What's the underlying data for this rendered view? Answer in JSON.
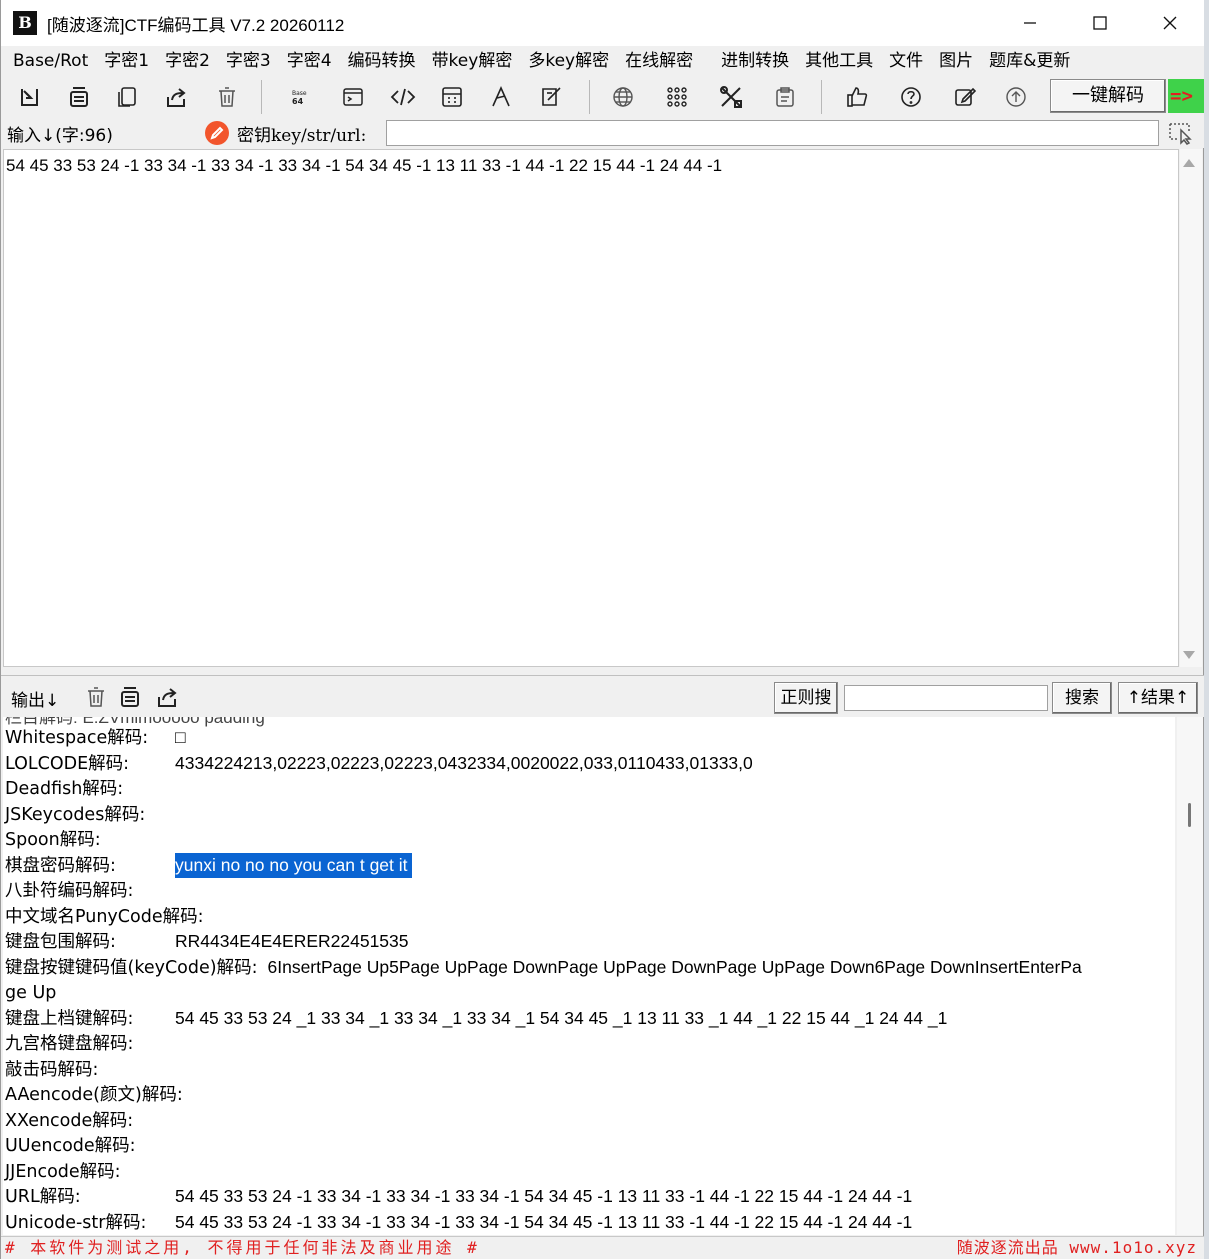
{
  "window": {
    "logo_text": "B",
    "title": "[随波逐流]CTF编码工具 V7.2  20260112"
  },
  "menu": [
    "Base/Rot",
    "字密1",
    "字密2",
    "字密3",
    "字密4",
    "编码转换",
    "带key解密",
    "多key解密",
    "在线解密",
    "进制转换",
    "其他工具",
    "文件",
    "图片",
    "题库&更新"
  ],
  "toolbar": {
    "decode_all": "一键解码",
    "arrow": "=>"
  },
  "input": {
    "label": "输入↓(字:96)",
    "key_label": "密钥key/str/url:",
    "key_value": "",
    "text": "54 45 33 53 24 -1 33 34 -1 33 34 -1 33 34 -1 54 34 45 -1 13 11 33 -1 44 -1 22 15 44 -1 24 44 -1"
  },
  "output_bar": {
    "label": "输出↓",
    "regex_button": "正则搜",
    "regex_value": "",
    "search_button": "搜索",
    "result_button": "↑结果↑"
  },
  "output": {
    "cutoff_line": "栏目解码:        E:ZVmlmooooo padding",
    "lines": [
      {
        "label": "Whitespace解码:",
        "value": "□"
      },
      {
        "label": "LOLCODE解码:",
        "value": "4334224213,02223,02223,02223,0432334,0020022,033,0110433,01333,0"
      },
      {
        "label": "Deadfish解码:",
        "value": ""
      },
      {
        "label": "JSKeycodes解码:",
        "value": ""
      },
      {
        "label": "Spoon解码:",
        "value": ""
      },
      {
        "label": "棋盘密码解码:",
        "value": "yunxi no no no you can t get it",
        "selected": true
      },
      {
        "label": "八卦符编码解码:",
        "value": ""
      },
      {
        "label": "中文域名PunyCode解码:",
        "value": ""
      },
      {
        "label": "键盘包围解码:",
        "value": "RR4434E4E4ERER22451535"
      },
      {
        "label": "键盘按键键码值(keyCode)解码:",
        "value": "6InsertPage Up5Page UpPage DownPage UpPage DownPage UpPage Down6Page DownInsertEnterPa",
        "inline": true
      },
      {
        "label": "ge Up",
        "value": ""
      },
      {
        "label": "键盘上档键解码:",
        "value": "54 45 33 53 24 _1 33 34 _1 33 34 _1 33 34 _1 54 34 45 _1 13 11 33 _1 44 _1 22 15 44 _1 24 44 _1"
      },
      {
        "label": "九宫格键盘解码:",
        "value": ""
      },
      {
        "label": "敲击码解码:",
        "value": ""
      },
      {
        "label": "AAencode(颜文)解码:",
        "value": ""
      },
      {
        "label": "XXencode解码:",
        "value": ""
      },
      {
        "label": "UUencode解码:",
        "value": ""
      },
      {
        "label": "JJEncode解码:",
        "value": ""
      },
      {
        "label": "URL解码:",
        "value": "54 45 33 53 24 -1 33 34 -1 33 34 -1 33 34 -1 54 34 45 -1 13 11 33 -1 44 -1 22 15 44 -1 24 44 -1"
      },
      {
        "label": "Unicode-str解码:",
        "value": "54 45 33 53 24 -1 33 34 -1 33 34 -1 33 34 -1 54 34 45 -1 13 11 33 -1 44 -1 22 15 44 -1 24 44 -1"
      }
    ]
  },
  "status": {
    "left": "# 本软件为测试之用, 不得用于任何非法及商业用途 #",
    "right": "随波逐流出品 www.1o1o.xyz"
  },
  "colors": {
    "selection": "#0a64d2",
    "status_text": "#e02020",
    "accent_green": "#3fd24a",
    "key_icon": "#f2552c"
  }
}
